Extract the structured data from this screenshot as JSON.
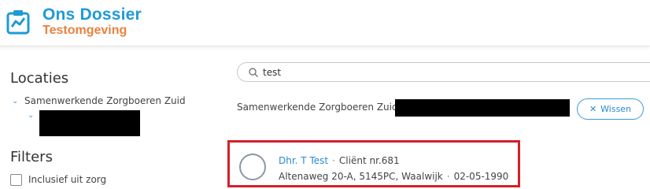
{
  "app": {
    "title": "Ons Dossier",
    "subtitle": "Testomgeving",
    "logo_icon": "chart-clipboard-icon",
    "title_color": "#1e9ad6",
    "subtitle_color": "#e8823f"
  },
  "sidebar": {
    "locations_heading": "Locaties",
    "location_item": "Samenwerkende Zorgboeren Zuid",
    "filters_heading": "Filters",
    "filter_checkbox_label": "Inclusief uit zorg",
    "filter_checked": false
  },
  "search": {
    "value": "test",
    "placeholder": ""
  },
  "breadcrumb": {
    "location": "Samenwerkende Zorgboeren Zuid"
  },
  "clear_button": {
    "label": "Wissen"
  },
  "result": {
    "name": "Dhr. T Test",
    "client_number": "Cliënt nr.681",
    "address": "Altenaweg 20-A, 5145PC, Waalwijk",
    "birth_date": "02-05-1990",
    "separator": "·"
  },
  "colors": {
    "accent": "#2a8ad0",
    "highlight_border": "#d3202a"
  }
}
